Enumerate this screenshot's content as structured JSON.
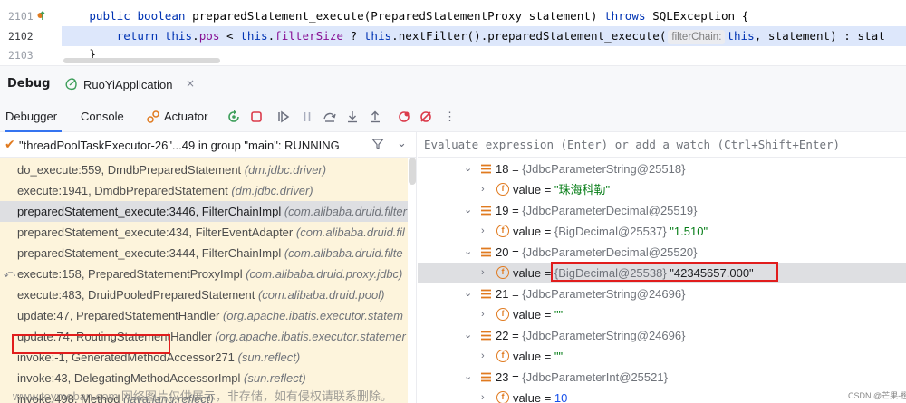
{
  "editor": {
    "line_numbers": [
      "2101",
      "2102",
      "2103"
    ],
    "line1": {
      "kw1": "public",
      "kw2": "boolean",
      "sig": "preparedStatement_execute(PreparedStatementProxy statement)",
      "kw3": "throws",
      "tail": "SQLException {"
    },
    "line2": {
      "kw1": "return",
      "kw2": "this",
      "fld1": "pos",
      "op1": "<",
      "kw3": "this",
      "fld2": "filterSize",
      "op2": "?",
      "kw4": "this",
      "call": ".nextFilter().preparedStatement_execute(",
      "hint": "filterChain:",
      "kw5": "this",
      "rest": ", statement) : stat"
    },
    "line3": "}"
  },
  "debug": {
    "title": "Debug",
    "run_config": "RuoYiApplication",
    "close_glyph": "×"
  },
  "toolbar": {
    "tab_debugger": "Debugger",
    "tab_console": "Console",
    "tab_actuator": "Actuator",
    "more": "⋮"
  },
  "thread": {
    "label": "\"threadPoolTaskExecutor-26\"...49 in group \"main\": RUNNING"
  },
  "frames": [
    {
      "m": "do_execute:559, DmdbPreparedStatement",
      "p": "(dm.jdbc.driver)"
    },
    {
      "m": "execute:1941, DmdbPreparedStatement",
      "p": "(dm.jdbc.driver)"
    },
    {
      "m": "preparedStatement_execute:3446, FilterChainImpl",
      "p": "(com.alibaba.druid.filter"
    },
    {
      "m": "preparedStatement_execute:434, FilterEventAdapter",
      "p": "(com.alibaba.druid.fil"
    },
    {
      "m": "preparedStatement_execute:3444, FilterChainImpl",
      "p": "(com.alibaba.druid.filte"
    },
    {
      "m": "execute:158, PreparedStatementProxyImpl",
      "p": "(com.alibaba.druid.proxy.jdbc)"
    },
    {
      "m": "execute:483, DruidPooledPreparedStatement",
      "p": "(com.alibaba.druid.pool)"
    },
    {
      "m": "update:47, PreparedStatementHandler",
      "p": "(org.apache.ibatis.executor.statem"
    },
    {
      "m": "update:74, RoutingStatementHandler",
      "p": "(org.apache.ibatis.executor.statemer"
    },
    {
      "m": "invoke:-1, GeneratedMethodAccessor271",
      "p": "(sun.reflect)"
    },
    {
      "m": "invoke:43, DelegatingMethodAccessorImpl",
      "p": "(sun.reflect)"
    },
    {
      "m": "invoke:498, Method",
      "p": "(java.lang.reflect)"
    }
  ],
  "evaluate": {
    "placeholder": "Evaluate expression (Enter) or add a watch (Ctrl+Shift+Enter)"
  },
  "variables": [
    {
      "kind": "entry",
      "name": "18",
      "obj": "{JdbcParameterString@25518}",
      "val": ""
    },
    {
      "kind": "field",
      "name": "value",
      "obj": "",
      "val": "\"珠海科勒\"",
      "vclass": "str"
    },
    {
      "kind": "entry",
      "name": "19",
      "obj": "{JdbcParameterDecimal@25519}",
      "val": ""
    },
    {
      "kind": "field",
      "name": "value",
      "obj": "{BigDecimal@25537}",
      "val": "\"1.510\"",
      "vclass": "str"
    },
    {
      "kind": "entry",
      "name": "20",
      "obj": "{JdbcParameterDecimal@25520}",
      "val": ""
    },
    {
      "kind": "field",
      "name": "value",
      "obj": "{BigDecimal@25538}",
      "val": "\"42345657.000\"",
      "vclass": "str",
      "selected": true
    },
    {
      "kind": "entry",
      "name": "21",
      "obj": "{JdbcParameterString@24696}",
      "val": ""
    },
    {
      "kind": "field",
      "name": "value",
      "obj": "",
      "val": "\"\"",
      "vclass": "str"
    },
    {
      "kind": "entry",
      "name": "22",
      "obj": "{JdbcParameterString@24696}",
      "val": ""
    },
    {
      "kind": "field",
      "name": "value",
      "obj": "",
      "val": "\"\"",
      "vclass": "str"
    },
    {
      "kind": "entry",
      "name": "23",
      "obj": "{JdbcParameterInt@25521}",
      "val": ""
    },
    {
      "kind": "field",
      "name": "value",
      "obj": "",
      "val": "10",
      "vclass": "num"
    }
  ],
  "watermark": "www.toymoban.com 网络图片仅供展示，非存储，如有侵权请联系删除。",
  "credit": "CSDN @芒果-橙"
}
